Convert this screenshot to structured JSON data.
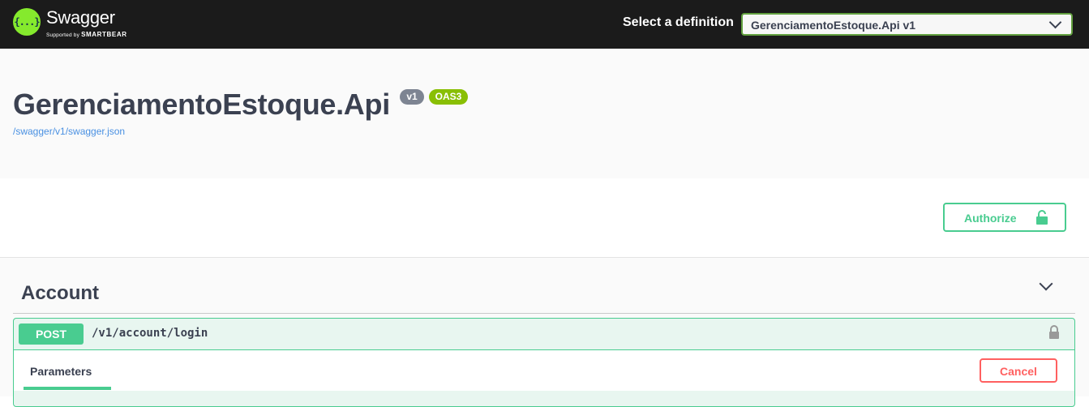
{
  "topbar": {
    "logo": {
      "name": "Swagger",
      "supported_by": "Supported by",
      "company": "SMARTBEAR",
      "mark_text": "{...}",
      "icon": "swagger-logo-icon",
      "mark_color": "#85ea2d"
    },
    "definition_label": "Select a definition",
    "definition_selected": "GerenciamentoEstoque.Api v1"
  },
  "info": {
    "title": "GerenciamentoEstoque.Api",
    "version_badge": "v1",
    "oas_badge": "OAS3",
    "spec_link": "/swagger/v1/swagger.json"
  },
  "auth": {
    "button_label": "Authorize",
    "icon": "unlocked-icon",
    "color": "#49cc90"
  },
  "tags": [
    {
      "name": "Account",
      "operations": [
        {
          "method": "POST",
          "path": "/v1/account/login",
          "lock_icon": "lock-icon",
          "method_color": "#49cc90",
          "tab_label": "Parameters",
          "cancel_label": "Cancel",
          "cancel_color": "#ff6060"
        }
      ]
    }
  ]
}
